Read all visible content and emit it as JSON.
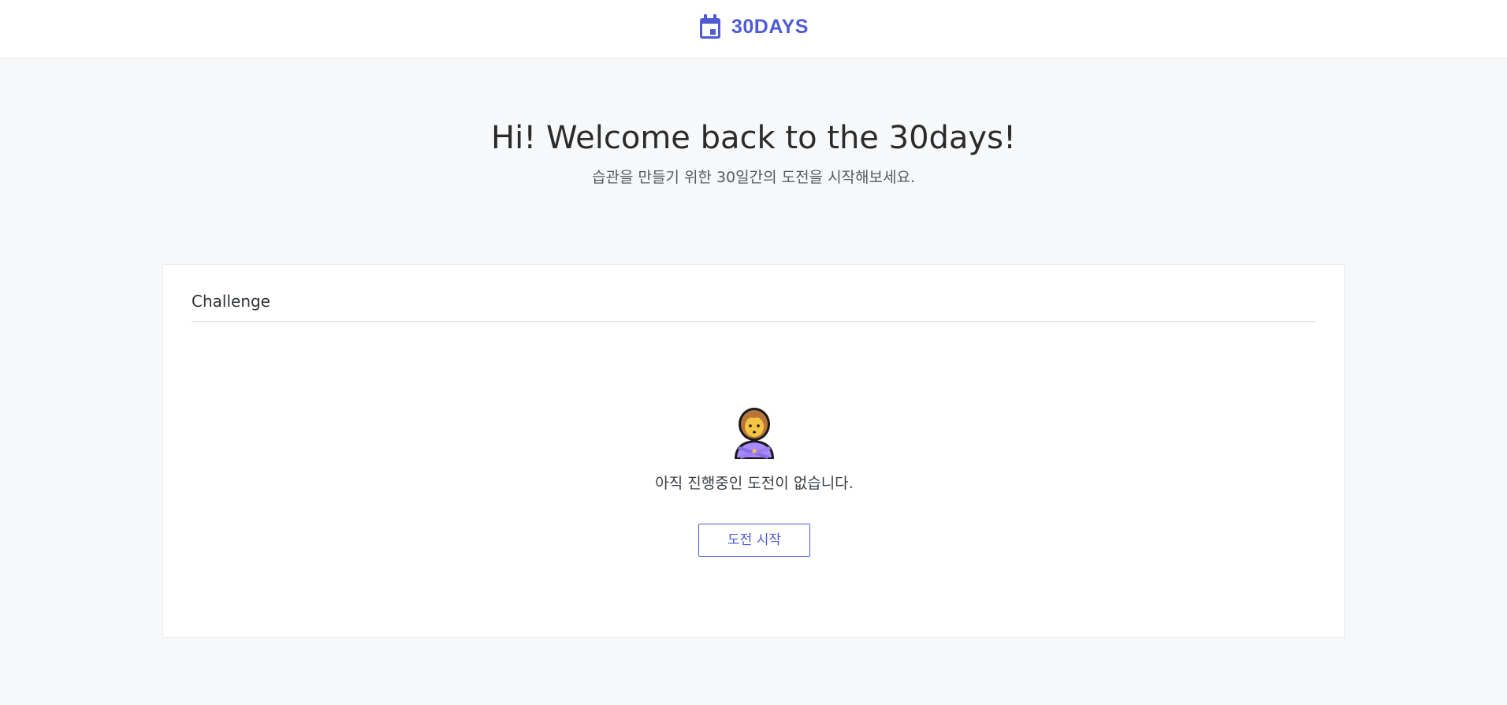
{
  "header": {
    "brand_name": "30DAYS",
    "brand_icon": "calendar-icon",
    "brand_color": "#4f5bd5"
  },
  "hero": {
    "title": "Hi! Welcome back to the 30days!",
    "subtitle": "습관을 만들기 위한 30일간의 도전을 시작해보세요."
  },
  "challenge": {
    "title": "Challenge",
    "empty_icon": "person-gesturing-no-icon",
    "empty_message": "아직 진행중인 도전이 없습니다.",
    "start_button_label": "도전 시작"
  }
}
